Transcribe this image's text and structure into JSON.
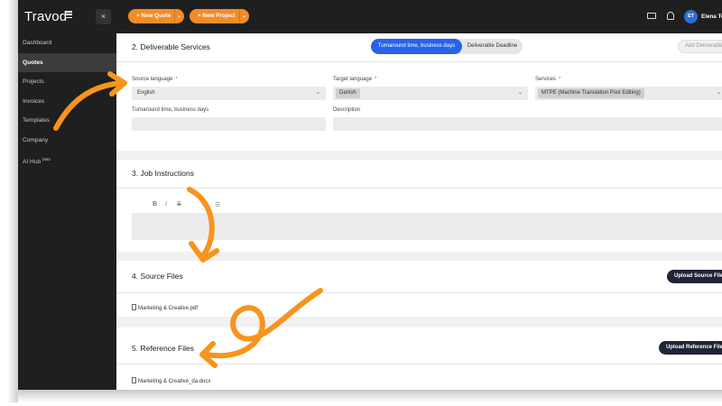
{
  "sidebar": {
    "logo": "Travod",
    "close": "×",
    "items": [
      {
        "label": "Dashboard",
        "active": false
      },
      {
        "label": "Quotes",
        "active": true
      },
      {
        "label": "Projects",
        "active": false
      },
      {
        "label": "Invoices",
        "active": false
      },
      {
        "label": "Templates",
        "active": false
      },
      {
        "label": "Company",
        "active": false
      },
      {
        "label": "AI Hub",
        "sup": "beta",
        "active": false
      }
    ]
  },
  "topbar": {
    "new_quote": "+ New Quote",
    "new_project": "+ New Project",
    "chevron": "⌄",
    "avatar": "ET",
    "user_name": "Elena Te"
  },
  "deliverable": {
    "title": "2. Deliverable Services",
    "toggle_active": "Turnaround time, business days",
    "toggle_inactive": "Deliverable Deadline",
    "add_button": "Add Deliverable",
    "source_language_label": "Source language",
    "source_language_value": "English",
    "target_language_label": "Target language",
    "target_language_value": "Danish",
    "services_label": "Services",
    "services_value": "MTPE (Machine Translation Post Editing)",
    "turnaround_label": "Turnaround time, business days",
    "description_label": "Description",
    "required_mark": "*"
  },
  "instructions": {
    "title": "3. Job Instructions",
    "toolbar": {
      "bold": "B",
      "italic": "I",
      "strike": "S",
      "clear": "T×",
      "list": "☰",
      "undo": "↶"
    }
  },
  "source_files": {
    "title": "4. Source Files",
    "upload_button": "Upload Source Files",
    "files": [
      "Marketing & Creative.pdf"
    ]
  },
  "reference_files": {
    "title": "5. Reference Files",
    "upload_button": "Upload Reference Files",
    "files": [
      "Marketing & Creative_da.docx"
    ]
  },
  "colors": {
    "accent": "#f28c28",
    "primary": "#2563eb",
    "sidebar": "#1f1f1f",
    "dark_button": "#1f2436"
  }
}
